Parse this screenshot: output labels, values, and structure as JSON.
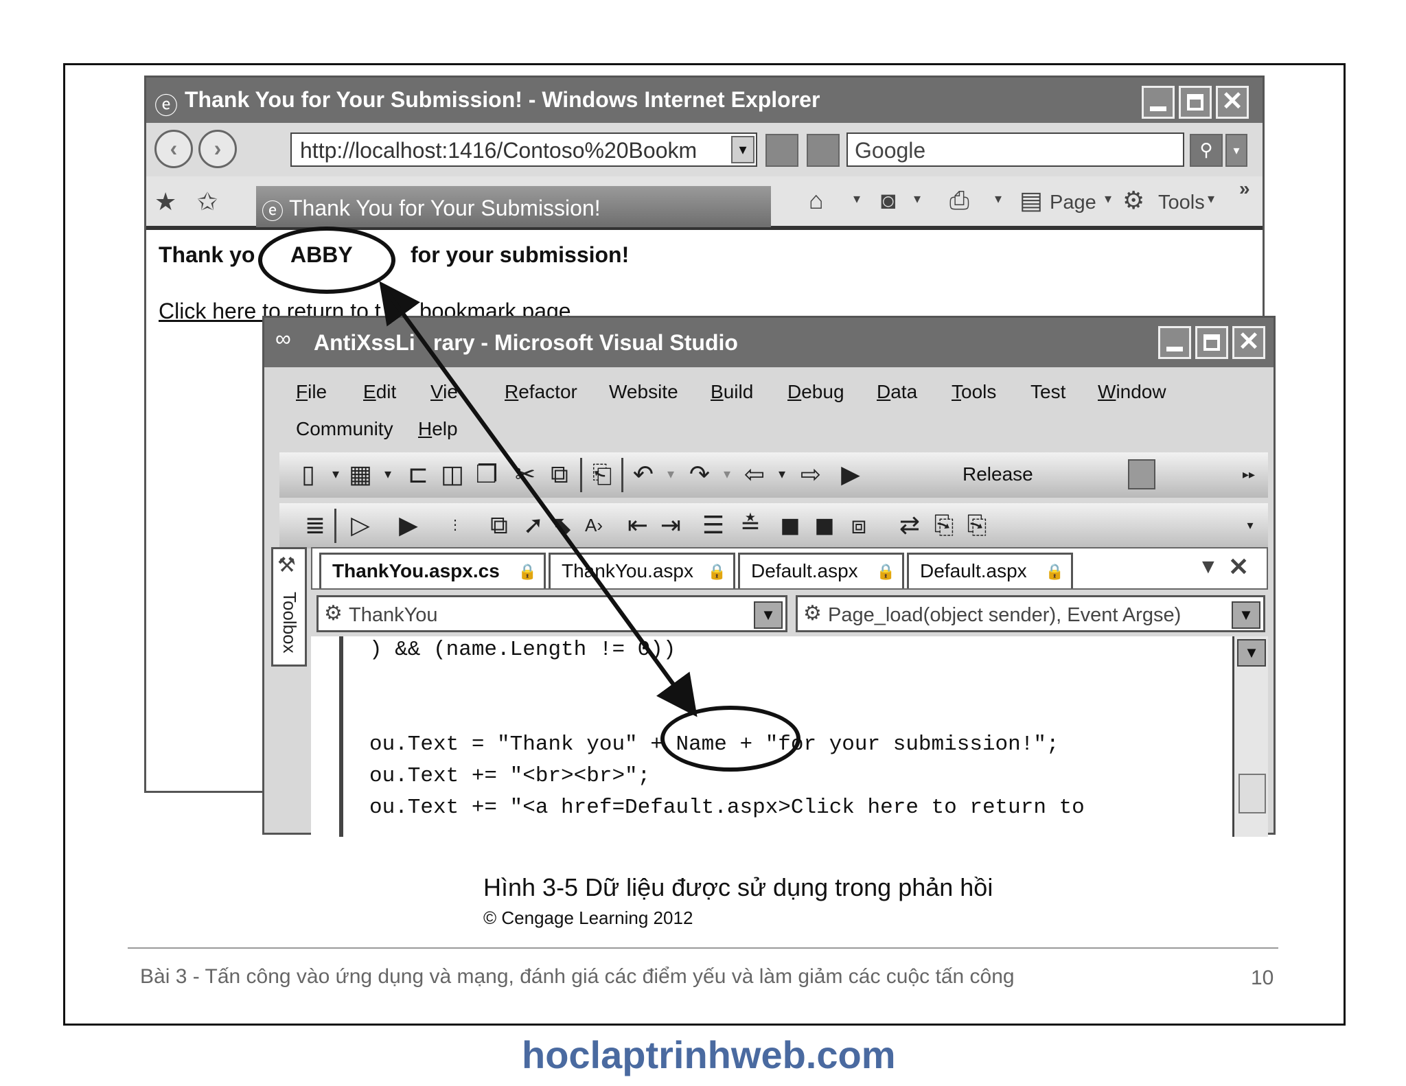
{
  "ie": {
    "title": "Thank You for Your Submission! - Windows Internet Explorer",
    "address": "http://localhost:1416/Contoso%20Bookm",
    "search_placeholder": "Google",
    "tab_title": "Thank You for Your Submission!",
    "cmd_page": "Page",
    "cmd_tools": "Tools",
    "more": "»",
    "content_thank_prefix": "Thank yo",
    "content_name": "ABBY",
    "content_thank_suffix": "for your submission!",
    "link_part1": "Click here to return to t",
    "link_part2": "bookmark page"
  },
  "vs": {
    "title_part1": "AntiXssLi",
    "title_part2": "rary - Microsoft Visual Studio",
    "menu": [
      {
        "u": "F",
        "rest": "ile"
      },
      {
        "u": "E",
        "rest": "dit"
      },
      {
        "u": "V",
        "rest": "ie"
      },
      {
        "u": "R",
        "rest": "efactor"
      },
      {
        "u": "",
        "rest": "Website"
      },
      {
        "u": "B",
        "rest": "uild"
      },
      {
        "u": "D",
        "rest": "ebug"
      },
      {
        "u": "D",
        "rest": "ata"
      },
      {
        "u": "T",
        "rest": "ools"
      },
      {
        "u": "",
        "rest": "Test"
      },
      {
        "u": "W",
        "rest": "indow"
      },
      {
        "u": "",
        "rest": "Community"
      },
      {
        "u": "H",
        "rest": "elp"
      }
    ],
    "release_label": "Release",
    "toolbox_label": "Toolbox",
    "doc_tabs": [
      "ThankYou.aspx.cs",
      "ThankYou.aspx",
      "Default.aspx",
      "Default.aspx"
    ],
    "class_combo": "ThankYou",
    "method_combo": "Page_load(object sender), Event Argse)",
    "code": [
      ") && (name.Length != 0))",
      "",
      "",
      "ou.Text = \"Thank you\" + Name + \"for your submission!\";",
      "ou.Text += \"<br><br>\";",
      "ou.Text += \"<a href=Default.aspx>Click here to return to"
    ]
  },
  "caption": {
    "figure": "Hình 3-5 Dữ liệu được sử dụng trong phản hồi",
    "copyright": "© Cengage Learning 2012"
  },
  "footer": {
    "text": "Bài 3 - Tấn công vào ứng dụng và mạng, đánh giá các điểm yếu và làm giảm các cuộc tấn công",
    "page_number": "10"
  },
  "brand": "hoclaptrinhweb.com",
  "icons": [
    "ie-logo-icon",
    "back-icon",
    "forward-icon",
    "refresh-icon",
    "stop-icon",
    "search-icon",
    "favorites-star-icon",
    "add-favorites-icon",
    "home-icon",
    "feeds-icon",
    "print-icon",
    "page-icon",
    "gear-icon",
    "minimize-icon",
    "maximize-icon",
    "close-icon",
    "lock-icon",
    "dropdown-arrow-icon"
  ],
  "colors": {
    "titlebar": "#6e6e6e",
    "brand": "#4a6aa0",
    "frame": "#111111"
  }
}
